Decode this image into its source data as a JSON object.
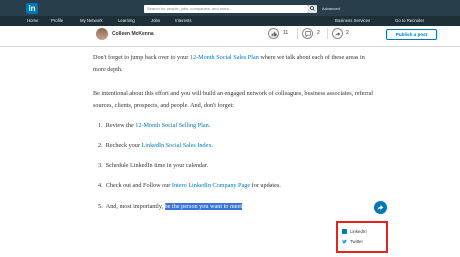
{
  "header": {
    "logo_text": "in",
    "search_placeholder": "Search for people, jobs, companies, and more...",
    "advanced": "Advanced",
    "nav": [
      "Home",
      "Profile",
      "My Network",
      "Learning",
      "Jobs",
      "Interests",
      "Business Services",
      "Go to Recruiter"
    ]
  },
  "subbar": {
    "author": "Colleen McKenna",
    "likes": "11",
    "comments": "2",
    "shares": "2",
    "publish": "Publish a post"
  },
  "article": {
    "para1_a": "Don't forget to jump back over to your ",
    "para1_link": "12-Month Social Sales Plan",
    "para1_b": " where we talk about each of these areas in more depth.",
    "para2": "Be intentional about this effort and you will build an engaged network of colleagues, business associates, referral sources, clients, prospects, and people. And, don't forget:",
    "list": [
      {
        "num": "1.",
        "pre": "Review the ",
        "link": "12-Month Social Selling Plan",
        "post": "."
      },
      {
        "num": "2.",
        "pre": "Recheck your ",
        "link": "LinkedIn Social Sales Index",
        "post": "."
      },
      {
        "num": "3.",
        "pre": "Schedule LinkedIn time in your calendar.",
        "link": "",
        "post": ""
      },
      {
        "num": "4.",
        "pre": "Check out and Follow our ",
        "link": "Intero LinkedIn Company Page",
        "post": " for updates."
      },
      {
        "num": "5.",
        "pre": "And, most importantly, ",
        "link": "",
        "post": "",
        "selected": "be the person you want to meet"
      }
    ]
  },
  "share": {
    "options": [
      "LinkedIn",
      "Twitter"
    ]
  },
  "colors": {
    "brand": "#0077b5",
    "header": "#283e4a",
    "highlight": "#e52420"
  }
}
